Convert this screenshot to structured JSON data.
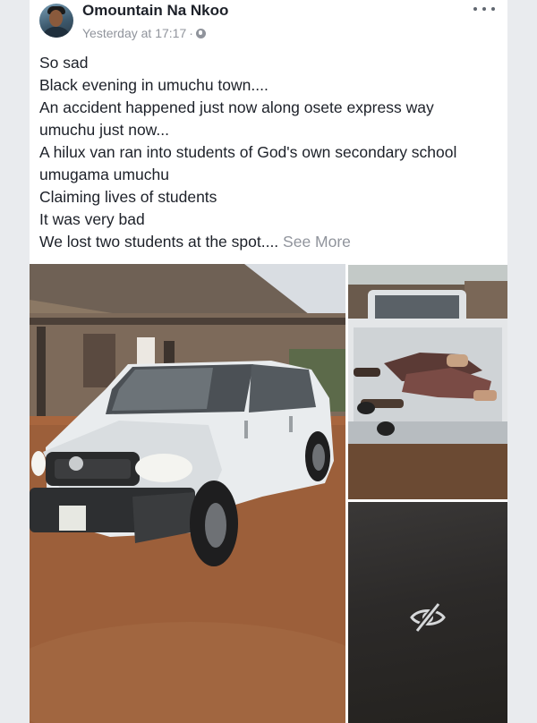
{
  "post": {
    "author": "Omountain Na Nkoo",
    "timestamp": "Yesterday at 17:17",
    "separator": "·",
    "privacy_icon": "globe-icon",
    "more_icon": "more-options-icon",
    "text_lines": [
      "So sad",
      "Black evening in umuchu town....",
      "An accident happened just now along osete express way",
      "umuchu just now...",
      "A hilux van ran into students of God's own secondary school",
      "umugama umuchu",
      "Claiming lives of students",
      "It was very bad",
      "We lost two students at the spot.... "
    ],
    "see_more": "See More"
  },
  "photos": {
    "count": 3,
    "hidden_icon": "eye-slash-icon"
  },
  "colors": {
    "background": "#e9ebee",
    "card": "#ffffff",
    "text": "#1d2129",
    "muted": "#90949c"
  }
}
